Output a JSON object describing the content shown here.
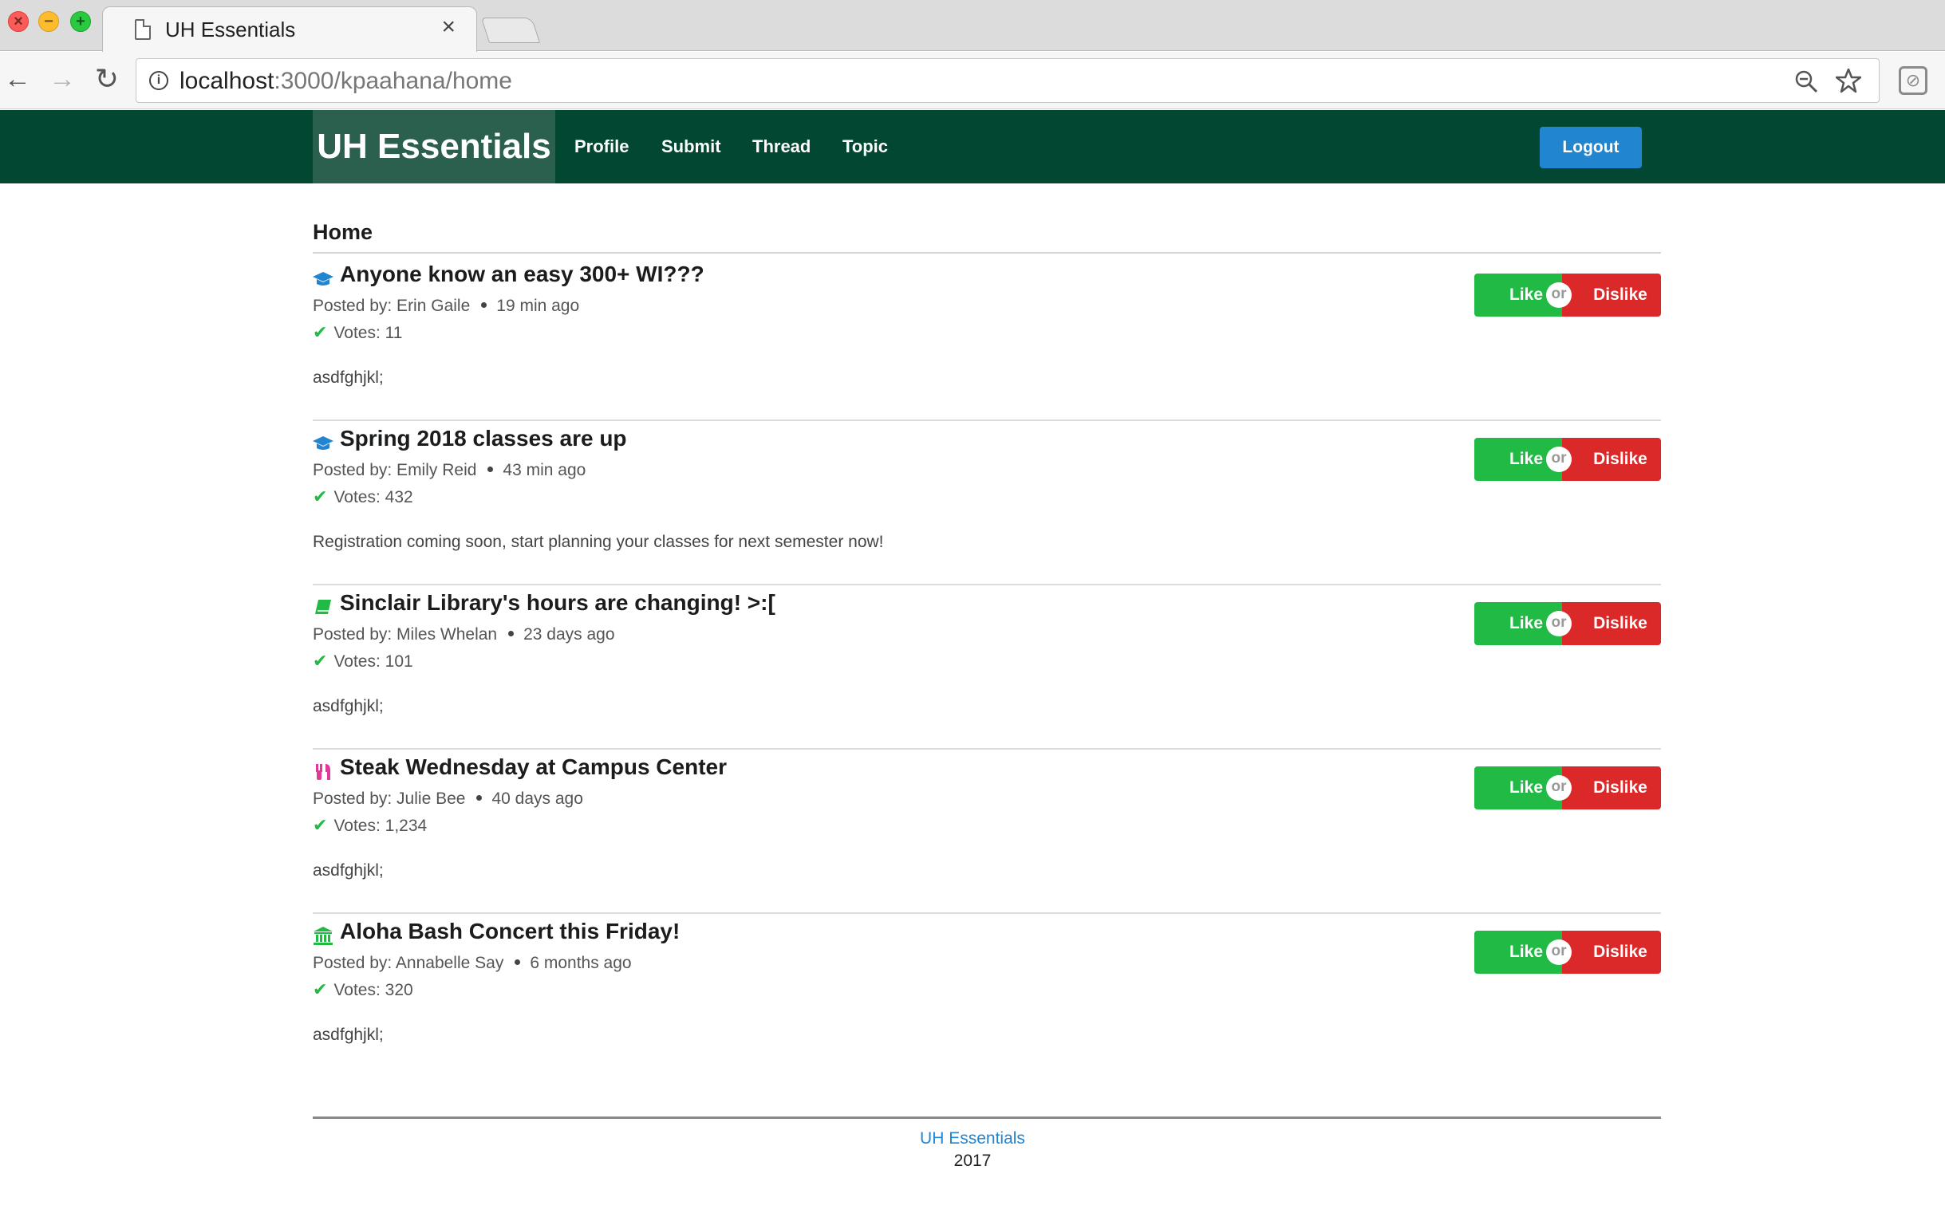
{
  "browser": {
    "tab_title": "UH Essentials",
    "tab_close": "×",
    "url_host": "localhost",
    "url_path": ":3000/kpaahana/home"
  },
  "navbar": {
    "brand": "UH Essentials",
    "links": [
      "Profile",
      "Submit",
      "Thread",
      "Topic"
    ],
    "logout": "Logout"
  },
  "page": {
    "title": "Home"
  },
  "posts": [
    {
      "icon": "graduation-cap-icon",
      "title": "Anyone know an easy 300+ WI???",
      "author": "Posted by: Erin Gaile",
      "time": "19 min ago",
      "votes": "Votes: 11",
      "body": "asdfghjkl;"
    },
    {
      "icon": "graduation-cap-icon",
      "title": "Spring 2018 classes are up",
      "author": "Posted by: Emily Reid",
      "time": "43 min ago",
      "votes": "Votes: 432",
      "body": "Registration coming soon, start planning your classes for next semester now!"
    },
    {
      "icon": "book-icon",
      "title": "Sinclair Library's hours are changing! >:[",
      "author": "Posted by: Miles Whelan",
      "time": "23 days ago",
      "votes": "Votes: 101",
      "body": "asdfghjkl;"
    },
    {
      "icon": "utensils-icon",
      "title": "Steak Wednesday at Campus Center",
      "author": "Posted by: Julie Bee",
      "time": "40 days ago",
      "votes": "Votes: 1,234",
      "body": "asdfghjkl;"
    },
    {
      "icon": "building-icon",
      "title": "Aloha Bash Concert this Friday!",
      "author": "Posted by: Annabelle Say",
      "time": "6 months ago",
      "votes": "Votes: 320",
      "body": "asdfghjkl;"
    }
  ],
  "buttons": {
    "like": "Like",
    "or": "or",
    "dislike": "Dislike"
  },
  "footer": {
    "link": "UH Essentials",
    "year": "2017"
  },
  "colors": {
    "navbar_bg": "#024731",
    "brand_bg": "#2b5f4e",
    "like": "#21ba45",
    "dislike": "#db2828",
    "logout": "#2185d0",
    "icon_blue": "#2185d0",
    "icon_green": "#21ba45",
    "icon_pink": "#e03997"
  }
}
